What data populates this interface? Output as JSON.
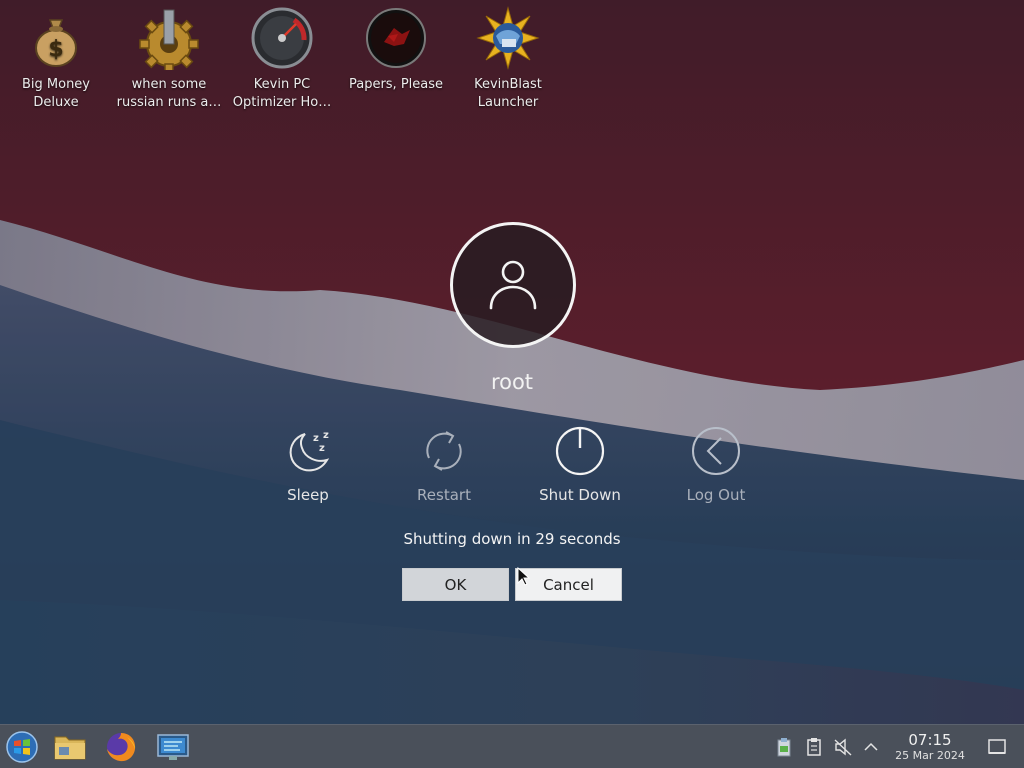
{
  "desktop": {
    "icons": [
      {
        "label": "Big Money\nDeluxe",
        "icon": "money-bag-icon"
      },
      {
        "label": "when some\nrussian runs a…",
        "icon": "gear-icon"
      },
      {
        "label": "Kevin PC\nOptimizer Ho…",
        "icon": "speedometer-icon"
      },
      {
        "label": "Papers, Please",
        "icon": "papers-please-icon"
      },
      {
        "label": "KevinBlast\nLauncher",
        "icon": "kevinblast-icon"
      }
    ]
  },
  "logout_dialog": {
    "username": "root",
    "actions": [
      {
        "label": "Sleep",
        "icon": "sleep-moon-icon"
      },
      {
        "label": "Restart",
        "icon": "restart-icon"
      },
      {
        "label": "Shut Down",
        "icon": "power-icon"
      },
      {
        "label": "Log Out",
        "icon": "logout-chevron-icon"
      }
    ],
    "countdown_text": "Shutting down in 29 seconds",
    "ok_label": "OK",
    "cancel_label": "Cancel"
  },
  "taskbar": {
    "launchers": [
      "start-menu-icon",
      "file-manager-icon",
      "firefox-icon",
      "system-monitor-icon"
    ],
    "tray": [
      "clipboard-icon",
      "notes-icon",
      "volume-muted-icon",
      "chevron-up-icon"
    ],
    "clock_time": "07:15",
    "clock_date": "25 Mar 2024",
    "show_desktop_icon": "show-desktop-icon"
  },
  "colors": {
    "wallpaper_top": "#6a1f2c",
    "wallpaper_bottom": "#1f3f5c",
    "taskbar": "#4a505a",
    "ok_button": "#d2d5d9",
    "cancel_button": "#f0f1f2"
  }
}
